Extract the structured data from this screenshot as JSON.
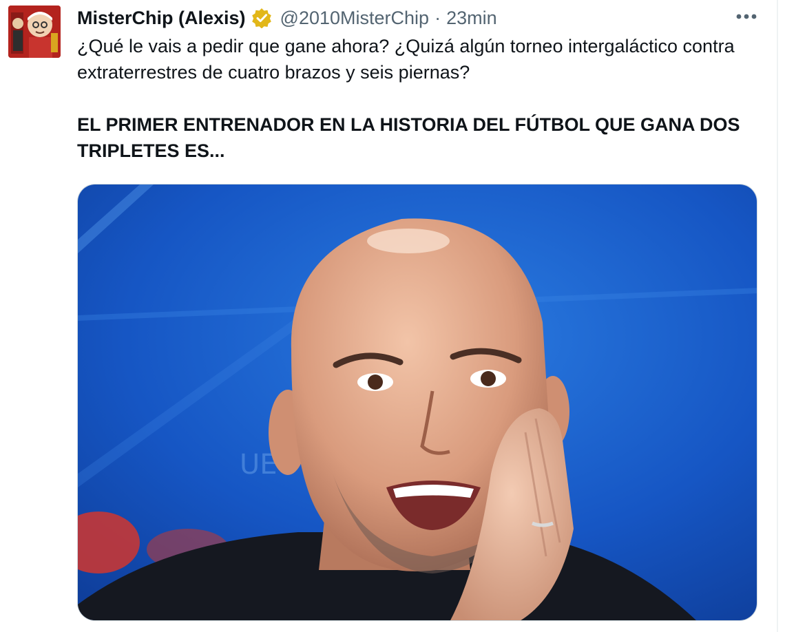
{
  "tweet": {
    "display_name": "MisterChip (Alexis)",
    "verified_badge": "verified-badge-icon",
    "handle": "@2010MisterChip",
    "separator": "·",
    "time": "23min",
    "more_icon": "more-horizontal-icon",
    "text_line": "¿Qué le vais a pedir que gane ahora? ¿Quizá algún torneo intergaláctico contra extraterrestres de cuatro brazos y seis piernas?",
    "text_bold": "EL PRIMER ENTRENADOR EN LA HISTORIA DEL FÚTBOL QUE GANA DOS TRIPLETES ES...",
    "media_description_icon": "photo-icon"
  },
  "colors": {
    "text_primary": "#0f1419",
    "text_secondary": "#536471",
    "badge_gold": "#e2b719",
    "media_background": "#1556c2"
  }
}
